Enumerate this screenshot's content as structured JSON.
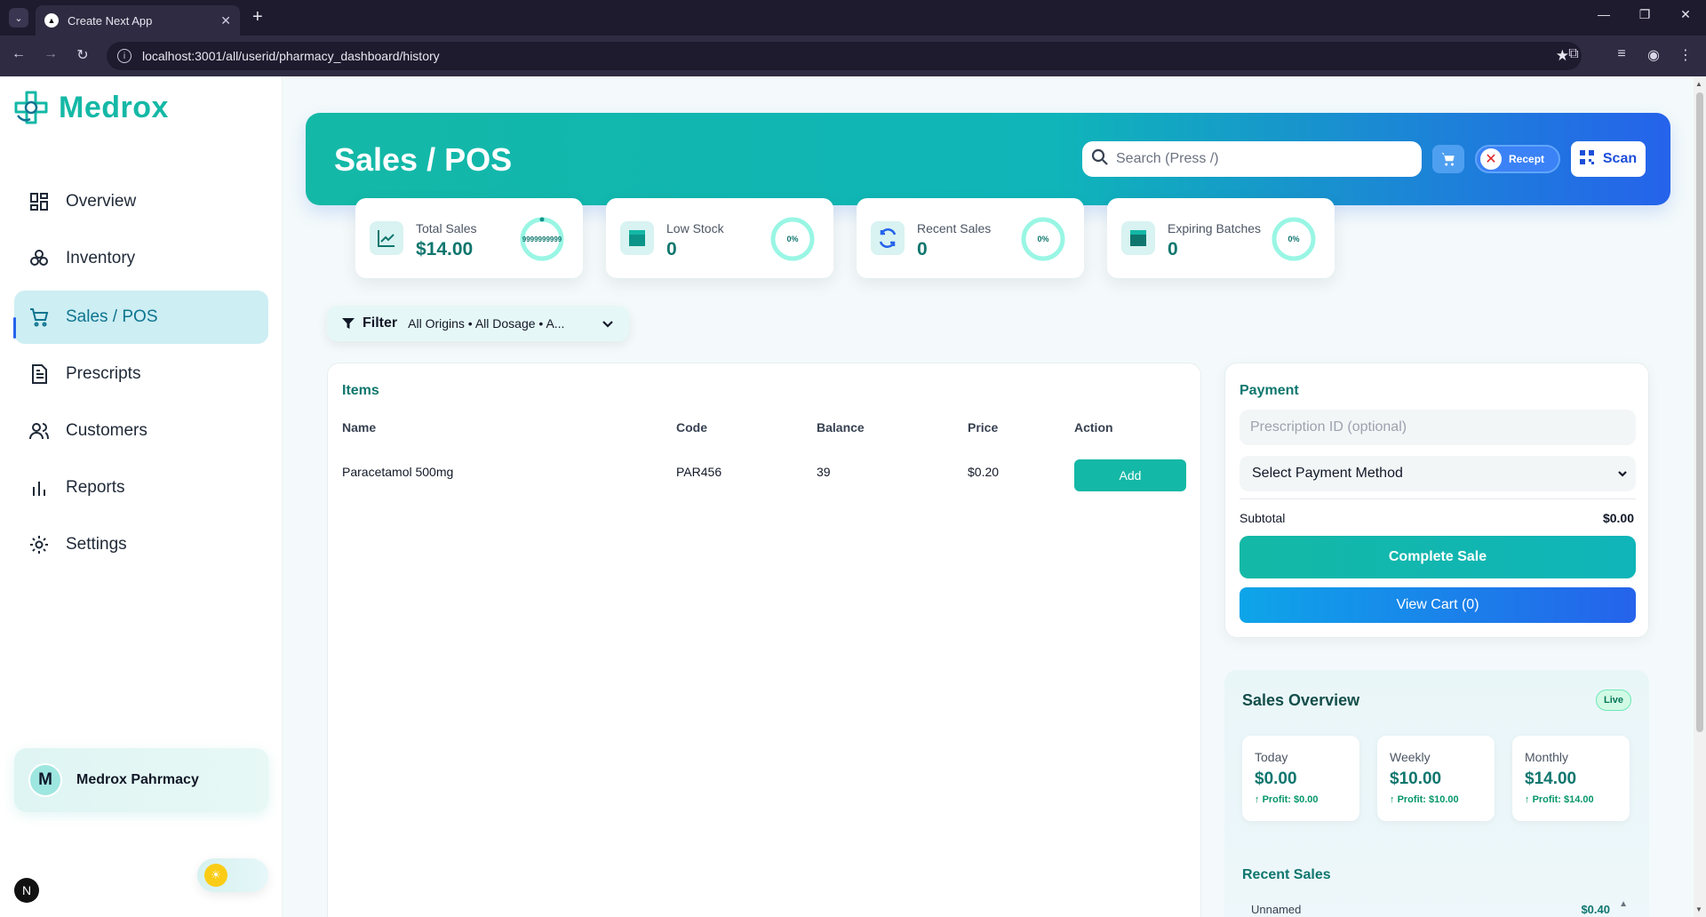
{
  "browser": {
    "tab_title": "Create Next App",
    "url": "localhost:3001/all/userid/pharmacy_dashboard/history"
  },
  "sidebar": {
    "brand": "Medrox",
    "items": [
      {
        "label": "Overview",
        "icon": "grid-icon"
      },
      {
        "label": "Inventory",
        "icon": "boxes-icon"
      },
      {
        "label": "Sales / POS",
        "icon": "cart-icon",
        "active": true
      },
      {
        "label": "Prescripts",
        "icon": "document-icon"
      },
      {
        "label": "Customers",
        "icon": "users-icon"
      },
      {
        "label": "Reports",
        "icon": "bar-chart-icon"
      },
      {
        "label": "Settings",
        "icon": "gear-icon"
      }
    ],
    "user": {
      "initial": "M",
      "name": "Medrox Pahrmacy"
    }
  },
  "header": {
    "title": "Sales / POS",
    "search_placeholder": "Search (Press /)",
    "receipt_label": "Recept",
    "scan_label": "Scan"
  },
  "stats": [
    {
      "label": "Total Sales",
      "value": "$14.00",
      "ring": "9999999999",
      "icon": "trend-up-icon"
    },
    {
      "label": "Low Stock",
      "value": "0",
      "ring": "0%",
      "icon": "box-icon"
    },
    {
      "label": "Recent Sales",
      "value": "0",
      "ring": "0%",
      "icon": "refresh-icon"
    },
    {
      "label": "Expiring Batches",
      "value": "0",
      "ring": "0%",
      "icon": "box-icon"
    }
  ],
  "filter": {
    "label": "Filter",
    "value": "All Origins • All Dosage • A..."
  },
  "items": {
    "title": "Items",
    "columns": [
      "Name",
      "Code",
      "Balance",
      "Price",
      "Action"
    ],
    "rows": [
      {
        "name": "Paracetamol 500mg",
        "code": "PAR456",
        "balance": "39",
        "price": "$0.20",
        "action": "Add"
      }
    ]
  },
  "payment": {
    "title": "Payment",
    "prescription_placeholder": "Prescription ID (optional)",
    "method_selected": "Select Payment Method",
    "subtotal_label": "Subtotal",
    "subtotal_value": "$0.00",
    "complete_label": "Complete Sale",
    "view_cart_label": "View Cart (0)"
  },
  "overview": {
    "title": "Sales Overview",
    "badge": "Live",
    "cards": [
      {
        "label": "Today",
        "value": "$0.00",
        "profit": "Profit: $0.00"
      },
      {
        "label": "Weekly",
        "value": "$10.00",
        "profit": "Profit: $10.00"
      },
      {
        "label": "Monthly",
        "value": "$14.00",
        "profit": "Profit: $14.00"
      }
    ],
    "recent_title": "Recent Sales",
    "recent": [
      {
        "name": "Unnamed",
        "amount": "$0.40"
      }
    ]
  },
  "colors": {
    "primary": "#14b8a6",
    "accent_blue": "#2563eb",
    "active_nav_bg": "#cdeef3"
  }
}
